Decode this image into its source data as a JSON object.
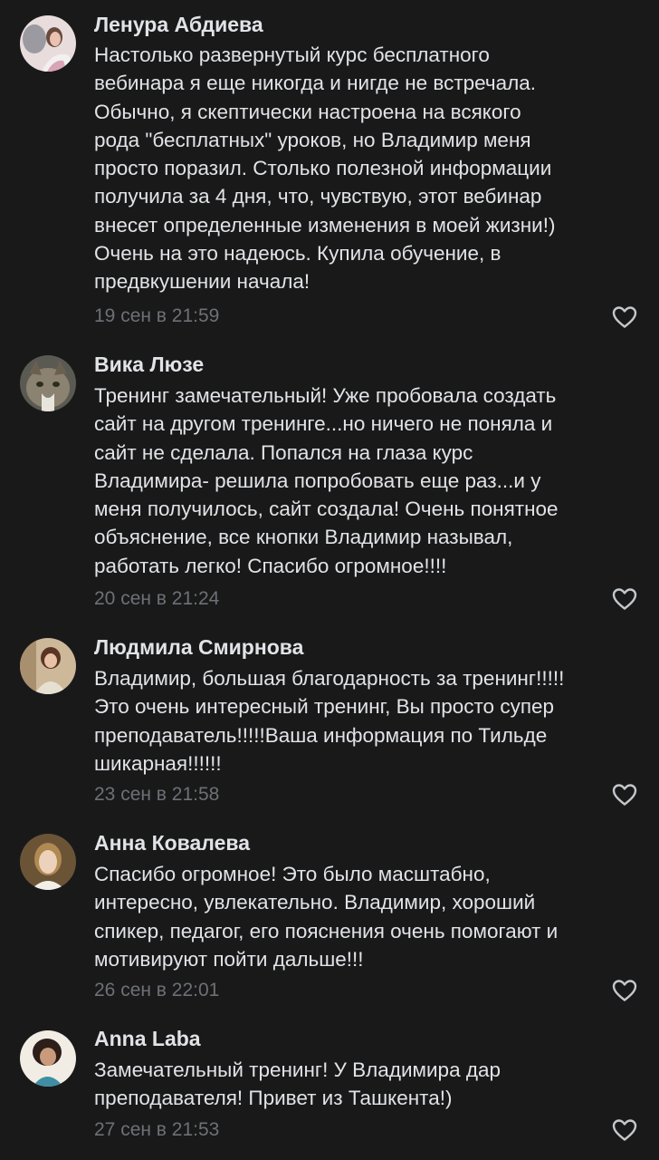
{
  "colors": {
    "background": "#19191a",
    "text": "#e1e3e6",
    "secondary": "#6d7075",
    "icon": "#c4c8cc"
  },
  "comments": [
    {
      "author": "Ленура Абдиева",
      "avatar_icon": "avatar-photo",
      "lines": [
        "Настолько развернутый курс бесплатного",
        "вебинара я еще никогда и нигде не встречала.",
        "Обычно, я скептически настроена на всякого",
        "рода \"бесплатных\" уроков, но Владимир меня",
        "просто поразил. Столько полезной информации",
        "получила за 4 дня, что, чувствую, этот вебинар",
        "внесет определенные изменения в моей жизни!)",
        "Очень на это надеюсь. Купила обучение, в",
        "предвкушении начала!"
      ],
      "date": "19 сен в 21:59",
      "like_icon": "heart-outline-icon"
    },
    {
      "author": "Вика Люзе",
      "avatar_icon": "avatar-cat-photo",
      "lines": [
        "Тренинг замечательный! Уже пробовала создать",
        "сайт на другом тренинге...но ничего не поняла и",
        "сайт не сделала. Попался на глаза курс",
        "Владимира- решила попробовать еще раз...и у",
        "меня получилось, сайт создала! Очень понятное",
        "объяснение, все кнопки Владимир называл,",
        "работать легко! Спасибо огромное!!!!"
      ],
      "date": "20 сен в 21:24",
      "like_icon": "heart-outline-icon"
    },
    {
      "author": "Людмила Смирнова",
      "avatar_icon": "avatar-photo",
      "lines": [
        "Владимир, большая благодарность за тренинг!!!!!",
        "Это очень интересный тренинг, Вы просто супер",
        "преподаватель!!!!!Ваша информация по Тильде",
        "шикарная!!!!!!"
      ],
      "date": "23 сен в 21:58",
      "like_icon": "heart-outline-icon"
    },
    {
      "author": "Анна Ковалева",
      "avatar_icon": "avatar-photo",
      "lines": [
        "Спасибо огромное! Это было масштабно,",
        "интересно, увлекательно. Владимир, хороший",
        "спикер, педагог, его пояснения очень помогают и",
        "мотивируют пойти дальше!!!"
      ],
      "date": "26 сен в 22:01",
      "like_icon": "heart-outline-icon"
    },
    {
      "author": "Anna Laba",
      "avatar_icon": "avatar-photo",
      "lines": [
        "Замечательный тренинг! У Владимира дар",
        "преподавателя! Привет из Ташкента!)"
      ],
      "date": "27 сен в 21:53",
      "like_icon": "heart-outline-icon"
    }
  ]
}
